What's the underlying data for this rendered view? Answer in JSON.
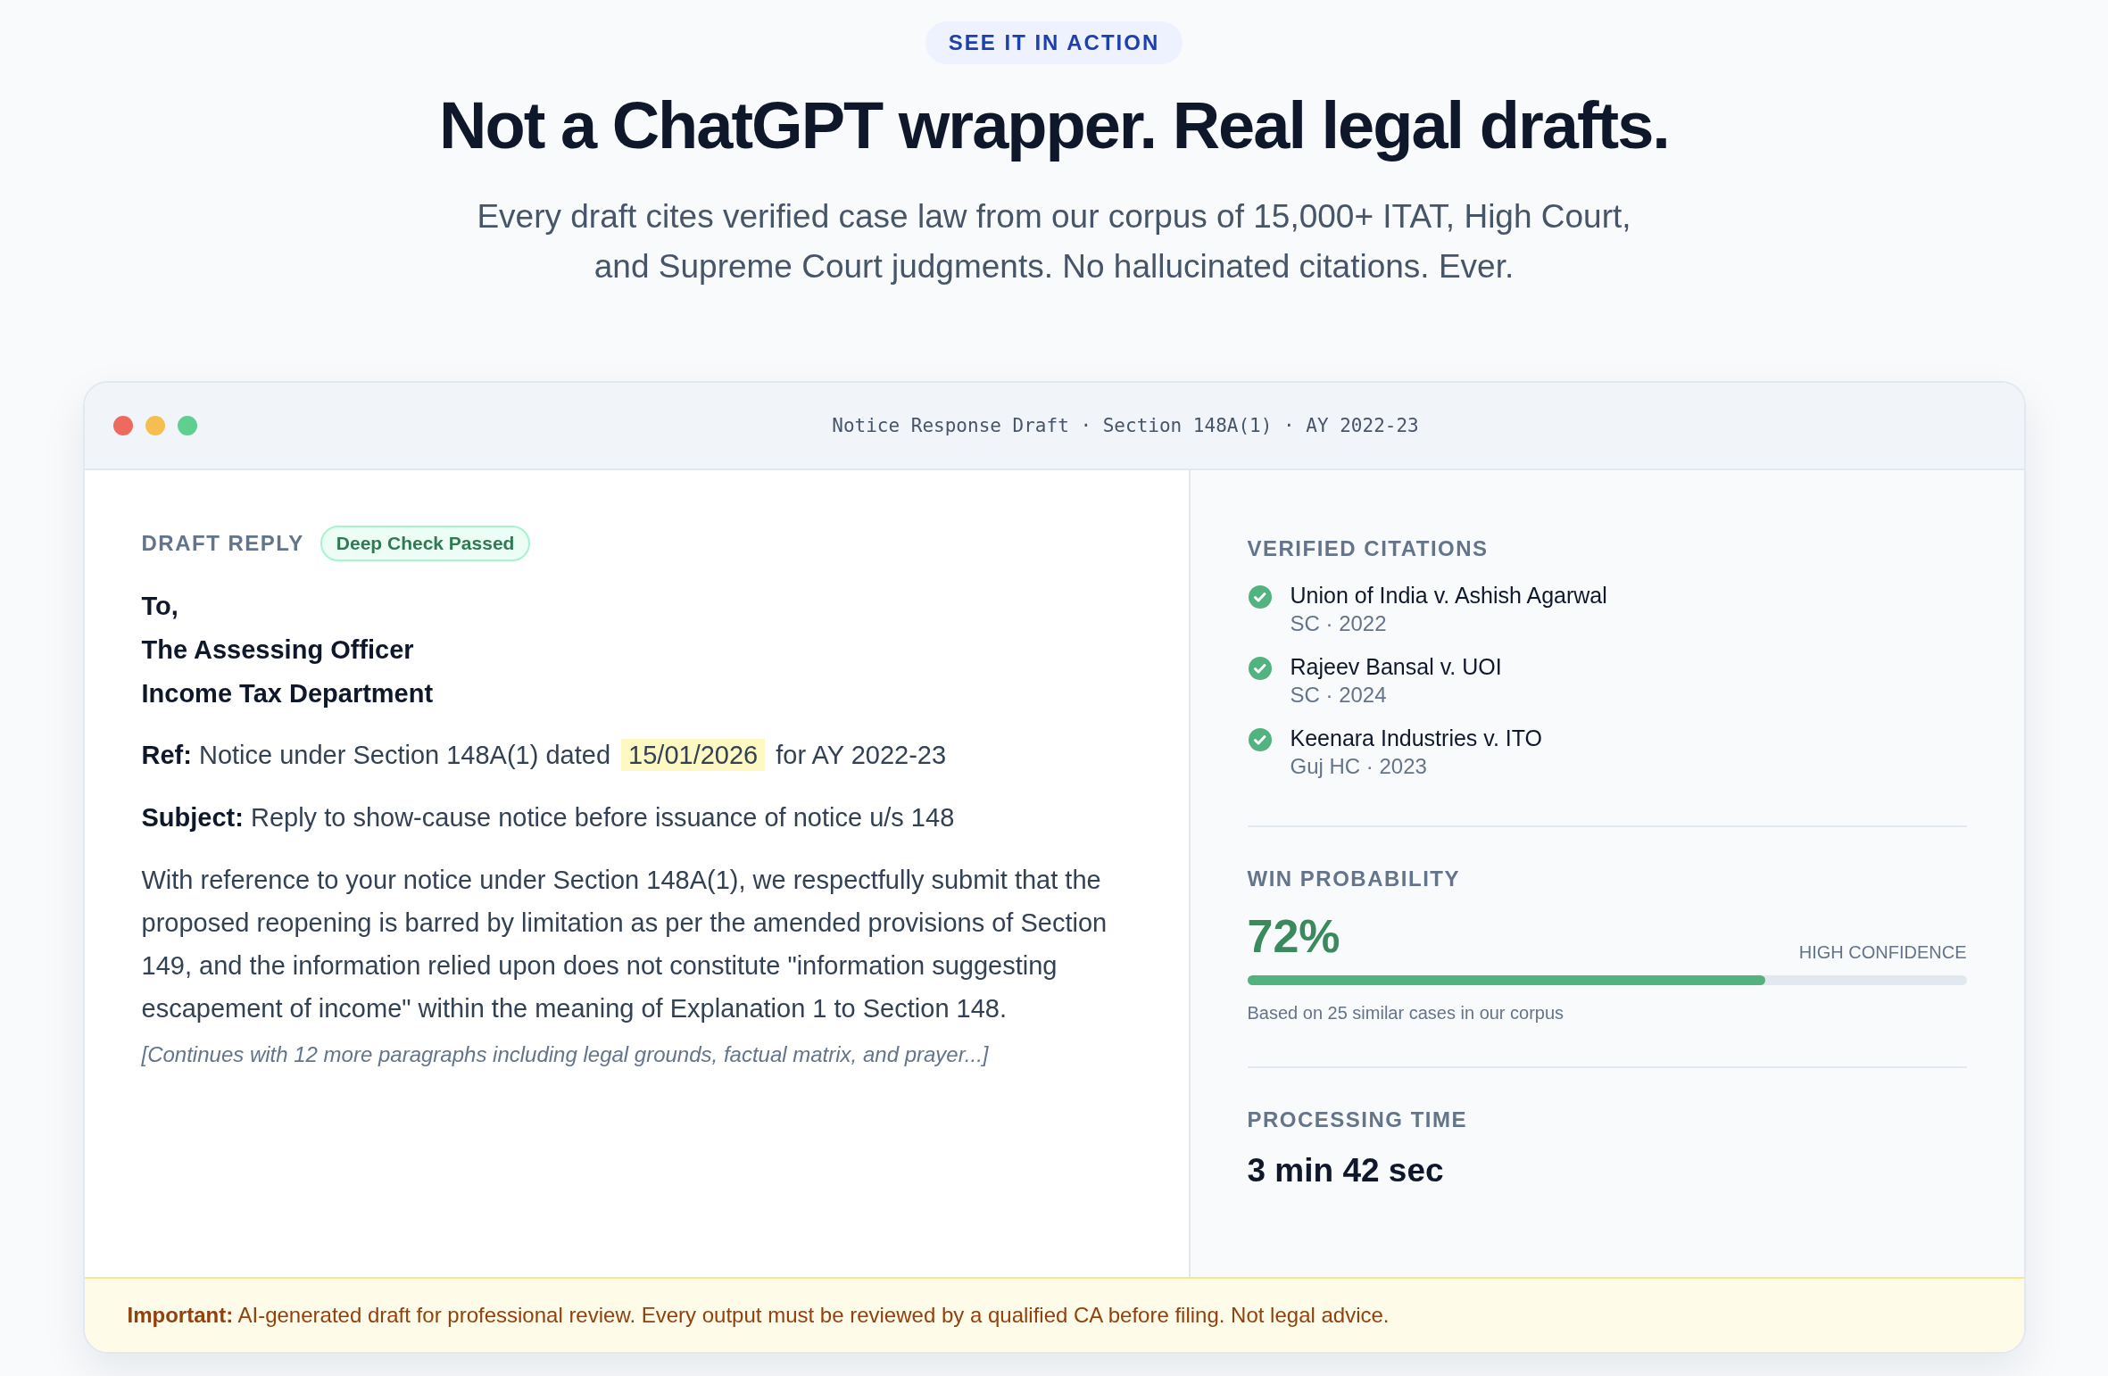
{
  "eyebrow": "SEE IT IN ACTION",
  "headline": "Not a ChatGPT wrapper. Real legal drafts.",
  "subtitle": "Every draft cites verified case law from our corpus of 15,000+ ITAT, High Court, and Supreme Court judgments. No hallucinated citations. Ever.",
  "window": {
    "title": "Notice Response Draft · Section 148A(1) · AY 2022-23"
  },
  "draft": {
    "label": "DRAFT REPLY",
    "badge": "Deep Check Passed",
    "address": [
      "To,",
      "The Assessing Officer",
      "Income Tax Department"
    ],
    "ref": {
      "before": "**Ref:** Notice under Section 148A(1) dated",
      "highlight": "15/01/2026",
      "after": "for AY 2022-23"
    },
    "subject": "**Subject:** Reply to show-cause notice before issuance of notice u/s 148",
    "body": "With reference to your notice under Section 148A(1), we respectfully submit that the proposed reopening is barred by limitation as per the amended provisions of Section 149, and the information relied upon does not constitute \"information suggesting escapement of income\" within the meaning of Explanation 1 to Section 148.",
    "note": "[Continues with 12 more paragraphs including legal grounds, factual matrix, and prayer...]"
  },
  "sidebar": {
    "citations_title": "VERIFIED CITATIONS",
    "citations": [
      {
        "name": "Union of India v. Ashish Agarwal",
        "meta": "SC · 2022",
        "verified": true
      },
      {
        "name": "Rajeev Bansal v. UOI",
        "meta": "SC · 2024",
        "verified": true
      },
      {
        "name": "Keenara Industries v. ITO",
        "meta": "Guj HC · 2023",
        "verified": true
      }
    ],
    "win": {
      "title": "WIN PROBABILITY",
      "value": "72%",
      "confidence": "HIGH CONFIDENCE",
      "level": 0.72,
      "note": "Based on 25 similar cases in our corpus"
    },
    "processing": {
      "title": "PROCESSING TIME",
      "value": "3 min 42 sec"
    }
  },
  "disclaimer": "**Important:** AI-generated draft for professional review. Every output must be reviewed by a qualified CA before filing. Not legal advice."
}
